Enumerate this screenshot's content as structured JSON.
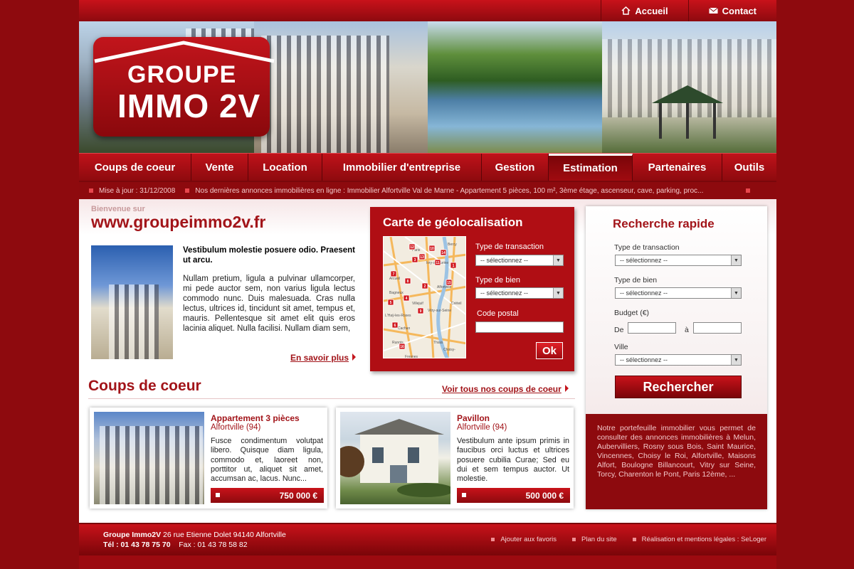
{
  "top_links": {
    "home": "Accueil",
    "contact": "Contact"
  },
  "logo": {
    "line1": "GROUPE",
    "line2": "IMMO 2V"
  },
  "nav": {
    "items": [
      "Coups de coeur",
      "Vente",
      "Location",
      "Immobilier d'entreprise",
      "Gestion",
      "Estimation",
      "Partenaires",
      "Outils"
    ],
    "active": "Estimation"
  },
  "ticker": {
    "update": "Mise à jour : 31/12/2008",
    "news": "Nos dernières annonces immobilières en ligne : Immobilier Alfortville Val de Marne - Appartement 5 pièces, 100 m², 3ème étage, ascenseur, cave, parking, proc..."
  },
  "welcome": {
    "small": "Bienvenue sur",
    "site": "www.groupeimmo2v.fr"
  },
  "intro": {
    "lead": "Vestibulum molestie posuere odio. Praesent ut arcu.",
    "body": "Nullam pretium, ligula a pulvinar ullamcorper, mi pede auctor sem, non varius ligula lectus commodo nunc. Duis malesuada. Cras nulla lectus, ultrices id, tincidunt sit amet, tempus et, mauris. Pellentesque sit amet elit quis eros lacinia aliquet. Nulla facilisi. Nullam diam sem,",
    "more": "En savoir plus"
  },
  "geo": {
    "title": "Carte de géolocalisation",
    "transaction_label": "Type de transaction",
    "bien_label": "Type de bien",
    "postal_label": "Code postal",
    "select_default": "-- sélectionnez --",
    "ok": "Ok",
    "map_labels": [
      "Ivry-sur-Seine",
      "Vitry-sur-Seine",
      "Choisy-",
      "Thiais",
      "Créteil",
      "Alfortville",
      "Rungis",
      "L'Haÿ-les-Roses",
      "Arcueil",
      "Bagneux",
      "Villejuif",
      "Cachan",
      "Fresnes",
      "Paris",
      "Bercy"
    ],
    "map_markers": [
      "12",
      "13",
      "10",
      "11",
      "3",
      "2",
      "7",
      "8",
      "5",
      "4",
      "9",
      "6",
      "1",
      "14",
      "15",
      "16"
    ]
  },
  "search": {
    "title": "Recherche rapide",
    "transaction_label": "Type de transaction",
    "bien_label": "Type de bien",
    "budget_label": "Budget (€)",
    "de": "De",
    "a": "à",
    "ville_label": "Ville",
    "select_default": "-- sélectionnez --",
    "button": "Rechercher",
    "info": "Notre portefeuille immobilier vous permet de consulter des annonces immobilières à Melun, Aubervilliers, Rosny sous Bois, Saint Maurice, Vincennes, Choisy le Roi, Alfortville, Maisons Alfort, Boulogne Billancourt, Vitry sur Seine, Torcy, Charenton le Pont, Paris 12ème, ..."
  },
  "coups": {
    "title": "Coups de coeur",
    "see_all": "Voir tous nos coups de coeur",
    "cards": [
      {
        "title": "Appartement 3 pièces",
        "city": "Alfortville (94)",
        "desc": "Fusce condimentum volutpat libero. Quisque diam ligula, commodo et, laoreet non, porttitor ut, aliquet sit amet, accumsan ac, lacus. Nunc...",
        "price": "750 000 €"
      },
      {
        "title": "Pavillon",
        "city": "Alfortville (94)",
        "desc": "Vestibulum ante ipsum primis in faucibus orci luctus et ultrices posuere cubilia Curae; Sed eu dui et sem tempus auctor. Ut molestie.",
        "price": "500 000 €"
      }
    ]
  },
  "footer": {
    "company": "Groupe Immo2V",
    "address": "26 rue Etienne Dolet 94140 Alfortville",
    "tel": "Tél : 01 43 78 75 70",
    "fax": "Fax : 01 43 78 58 82",
    "links": [
      "Ajouter aux favoris",
      "Plan du site",
      "Réalisation et mentions légales : SeLoger"
    ]
  },
  "colors": {
    "brand_red": "#a21419",
    "dark_red": "#8d0a0e",
    "bright_red": "#c8121a"
  }
}
